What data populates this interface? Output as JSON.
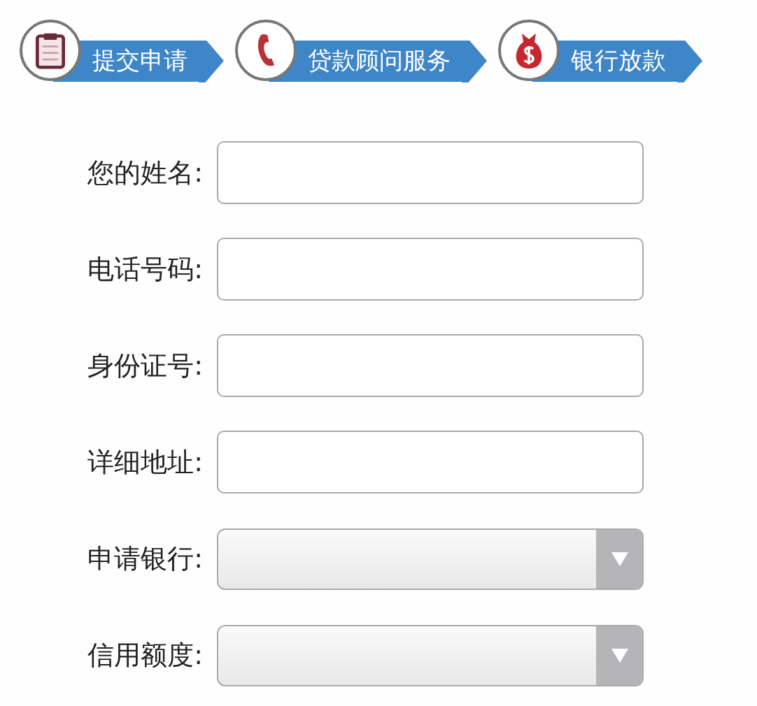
{
  "steps": [
    {
      "label": "提交申请"
    },
    {
      "label": "贷款顾问服务"
    },
    {
      "label": "银行放款"
    }
  ],
  "fields": [
    {
      "label": "您的姓名:",
      "kind": "text"
    },
    {
      "label": "电话号码:",
      "kind": "text"
    },
    {
      "label": "身份证号:",
      "kind": "text"
    },
    {
      "label": "详细地址:",
      "kind": "text"
    },
    {
      "label": "申请银行:",
      "kind": "select"
    },
    {
      "label": "信用额度:",
      "kind": "select"
    }
  ]
}
